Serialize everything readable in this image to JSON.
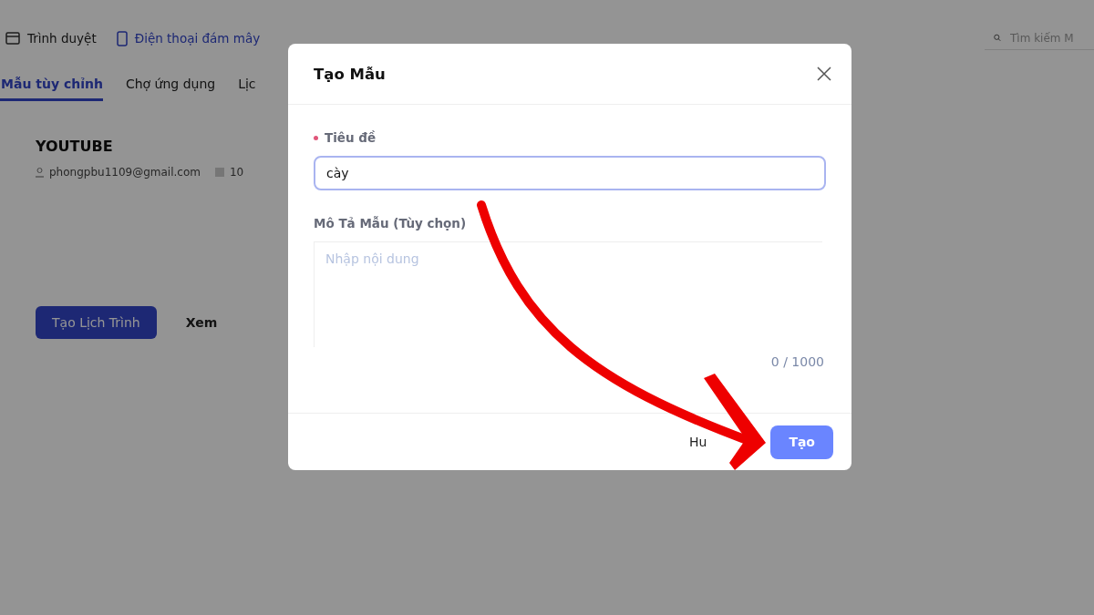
{
  "topbar": {
    "items": [
      {
        "label": "Trình duyệt",
        "kind": "browser",
        "selected": false
      },
      {
        "label": "Điện thoại đám mây",
        "kind": "phone",
        "selected": true
      }
    ],
    "search": {
      "placeholder": "Tìm kiếm M"
    }
  },
  "tabs": [
    {
      "label": "Mẫu tùy chỉnh",
      "selected": true
    },
    {
      "label": "Chợ ứng dụng",
      "selected": false
    },
    {
      "label": "Lịc",
      "selected": false
    }
  ],
  "card": {
    "title": "YOUTUBE",
    "email": "phongpbu1109@gmail.com",
    "count": "10",
    "buttons": [
      {
        "label": "Tạo Lịch Trình",
        "kind": "primary"
      },
      {
        "label": "Xem",
        "kind": "plain"
      }
    ]
  },
  "dialog": {
    "title": "Tạo Mẫu",
    "fields": [
      {
        "label": "Tiêu đề",
        "required": true,
        "kind": "input",
        "value": "cày"
      },
      {
        "label": "Mô Tả Mẫu (Tùy chọn)",
        "required": false,
        "kind": "textarea",
        "placeholder": "Nhập nội dung",
        "counter": "0 / 1000"
      }
    ],
    "buttons": [
      {
        "label": "Hu",
        "kind": "plain"
      },
      {
        "label": "Tạo",
        "kind": "primary"
      }
    ]
  }
}
